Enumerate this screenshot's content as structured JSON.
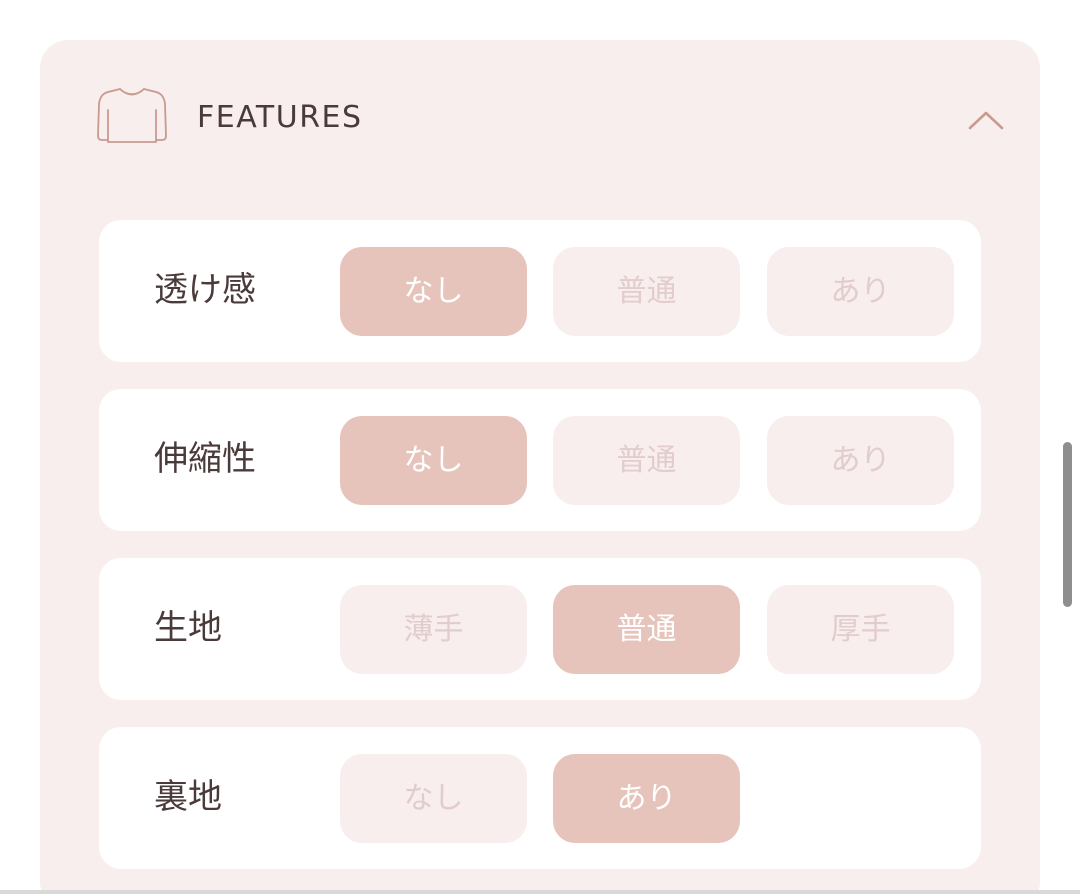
{
  "section": {
    "title": "FEATURES",
    "icon": "sweater-icon",
    "toggle_icon": "chevron-up-icon"
  },
  "colors": {
    "card_background": "#f8eeee",
    "selected_option": "#e6c4bb",
    "unselected_option": "#f8eeee",
    "unselected_text": "#e2cccc",
    "label_text": "#4a3a3a",
    "icon_stroke": "#c99a8e"
  },
  "rows": [
    {
      "label": "透け感",
      "options": [
        "なし",
        "普通",
        "あり"
      ],
      "selected": "なし"
    },
    {
      "label": "伸縮性",
      "options": [
        "なし",
        "普通",
        "あり"
      ],
      "selected": "なし"
    },
    {
      "label": "生地",
      "options": [
        "薄手",
        "普通",
        "厚手"
      ],
      "selected": "普通"
    },
    {
      "label": "裏地",
      "options": [
        "なし",
        "あり"
      ],
      "selected": "あり"
    }
  ]
}
